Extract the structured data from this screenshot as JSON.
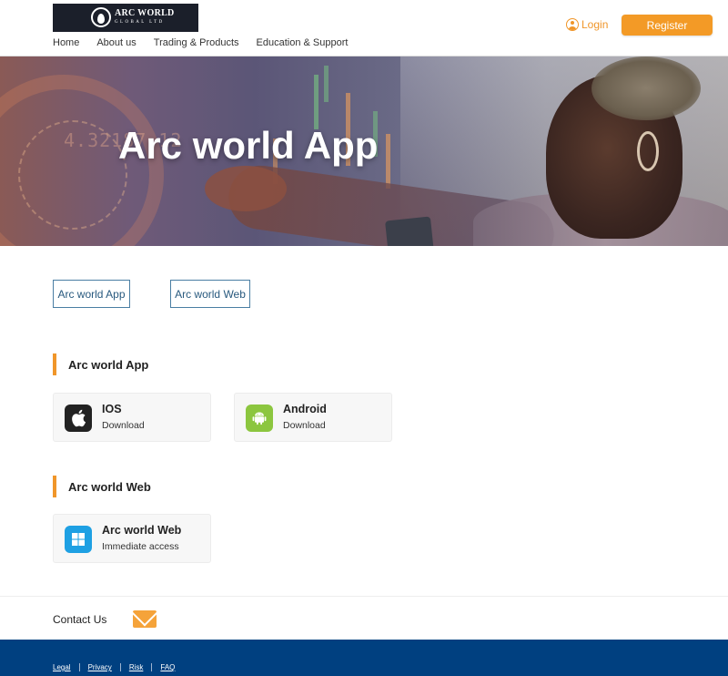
{
  "header": {
    "logo": {
      "line1": "ARC WORLD",
      "line2": "GLOBAL LTD"
    },
    "nav": [
      {
        "label": "Home"
      },
      {
        "label": "About us"
      },
      {
        "label": "Trading & Products"
      },
      {
        "label": "Education & Support"
      }
    ],
    "login_label": "Login",
    "register_label": "Register"
  },
  "hero": {
    "title": "Arc world App",
    "ticker_text": "4.32187.12"
  },
  "tabs": [
    {
      "label": "Arc world App"
    },
    {
      "label": "Arc world Web"
    }
  ],
  "sections": {
    "app": {
      "title": "Arc world App",
      "cards": [
        {
          "title": "IOS",
          "subtitle": "Download",
          "icon": "apple-icon"
        },
        {
          "title": "Android",
          "subtitle": "Download",
          "icon": "android-icon"
        }
      ]
    },
    "web": {
      "title": "Arc world Web",
      "cards": [
        {
          "title": "Arc world Web",
          "subtitle": "Immediate access",
          "icon": "windows-icon"
        }
      ]
    }
  },
  "contact": {
    "label": "Contact Us",
    "icon": "mail-icon"
  },
  "footer": {
    "links": [
      {
        "label": "Legal"
      },
      {
        "label": "Privacy"
      },
      {
        "label": "Risk"
      },
      {
        "label": "FAQ"
      }
    ]
  },
  "colors": {
    "accent": "#f39a26",
    "tab_border": "#4a7ea3",
    "footer_bg": "#004080",
    "android": "#8cc63f",
    "windows": "#1ea0e3"
  }
}
